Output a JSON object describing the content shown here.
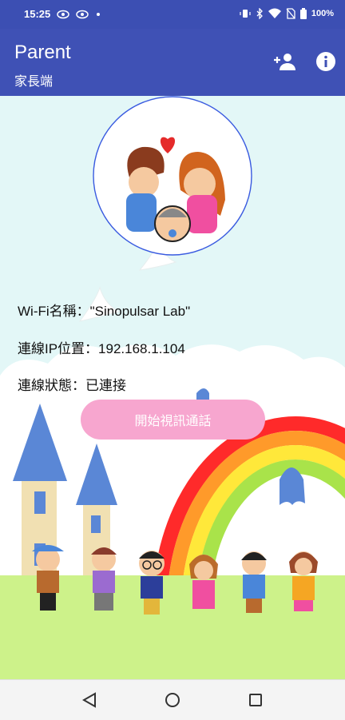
{
  "status_bar": {
    "time": "15:25",
    "battery": "100%",
    "icons": [
      "eye-icon",
      "eye-icon",
      "dot-icon",
      "vibrate-icon",
      "bluetooth-icon",
      "wifi-icon",
      "no-sim-icon",
      "battery-icon"
    ]
  },
  "app_bar": {
    "title": "Parent",
    "subtitle": "家長端",
    "actions": [
      "add-user-icon",
      "info-icon"
    ]
  },
  "info": {
    "wifi": "Wi-Fi名稱：\"Sinopulsar Lab\"",
    "ip": "連線IP位置：192.168.1.104",
    "status": "連線狀態：已連接"
  },
  "buttons": {
    "video_call": "開始視訊通話"
  },
  "nav_bar": {
    "icons": [
      "back-icon",
      "home-icon",
      "recents-icon"
    ]
  },
  "colors": {
    "app_bar": "#3f51b5",
    "status_bar": "#3c4fb3",
    "background": "#e3f7f7",
    "button": "#f7a6cf"
  }
}
